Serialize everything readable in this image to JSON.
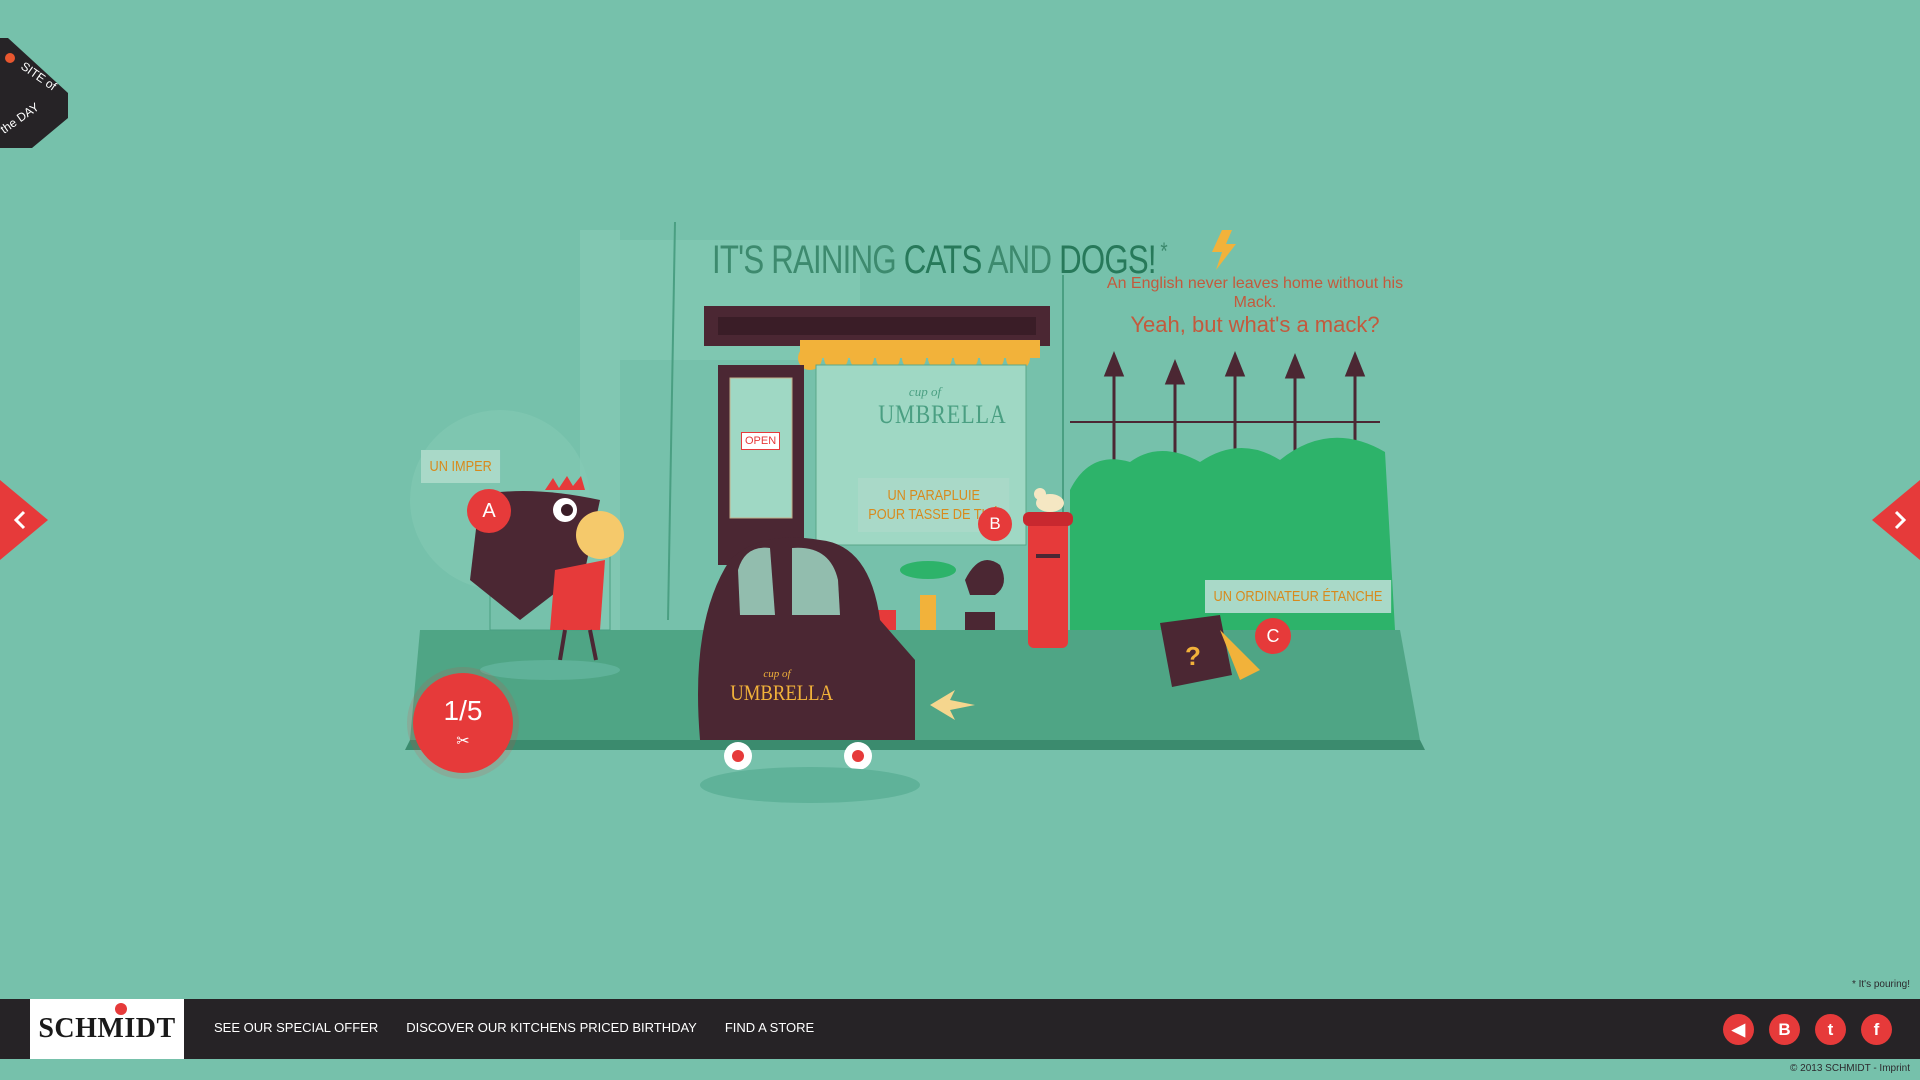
{
  "badge": {
    "line1": "SITE of",
    "line2": "the DAY"
  },
  "headline": {
    "part1": "IT'S RAINING ",
    "cats": "CATS",
    "and": " AND ",
    "dogs": "DOGS!",
    "star": "*"
  },
  "mack": {
    "line1": "An English never leaves home without his Mack.",
    "line2": "Yeah, but what's a mack?"
  },
  "shop": {
    "sign_small": "cup of",
    "sign_big": "UMBRELLA",
    "door_sign": "OPEN",
    "car_small": "cup of",
    "car_big": "UMBRELLA"
  },
  "labels": {
    "a": {
      "text": "UN IMPER",
      "pin": "A"
    },
    "b": {
      "line1": "UN PARAPLUIE",
      "line2": "POUR TASSE DE THÉ",
      "pin": "B"
    },
    "c": {
      "text": "UN ORDINATEUR ÉTANCHE",
      "pin": "C"
    }
  },
  "counter": {
    "value": "1/5",
    "icon": "scissors-icon"
  },
  "footnote": "* It's pouring!",
  "footer": {
    "logo": "SCHMIDT",
    "menu": [
      "SEE OUR SPECIAL OFFER",
      "DISCOVER OUR KITCHENS PRICED BIRTHDAY",
      "FIND A STORE"
    ],
    "socials": [
      {
        "icon": "sound-icon",
        "glyph": "◀"
      },
      {
        "icon": "blog-icon",
        "glyph": "B"
      },
      {
        "icon": "twitter-icon",
        "glyph": "t"
      },
      {
        "icon": "facebook-icon",
        "glyph": "f"
      }
    ],
    "copyright": "© 2013 SCHMIDT - Imprint"
  },
  "colors": {
    "background": "#76c1ab",
    "accent": "#e63a3a",
    "dark": "#3c2530",
    "footer": "#262326",
    "label_text": "#d88a1c"
  }
}
